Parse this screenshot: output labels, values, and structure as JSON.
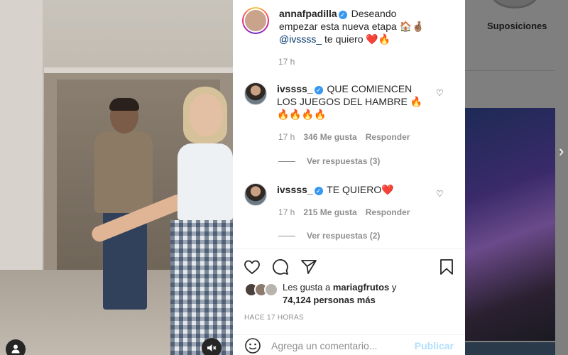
{
  "background": {
    "suggestions_label": "Suposiciones"
  },
  "caption": {
    "username": "annafpadilla",
    "text_before_mention": " Deseando empezar esta nueva etapa 🏠🤞🏽 ",
    "mention": "@ivssss_",
    "text_after_mention": " te quiero ❤️🔥",
    "time": "17 h"
  },
  "comments": [
    {
      "username": "ivssss_",
      "text": " QUE COMIENCEN LOS JUEGOS DEL HAMBRE 🔥🔥🔥🔥🔥",
      "time": "17 h",
      "likes": "346 Me gusta",
      "reply_label": "Responder",
      "view_replies": "Ver respuestas (3)"
    },
    {
      "username": "ivssss_",
      "text": " TE QUIERO❤️",
      "time": "17 h",
      "likes": "215 Me gusta",
      "reply_label": "Responder",
      "view_replies": "Ver respuestas (2)"
    }
  ],
  "likes": {
    "prefix": "Les gusta a ",
    "user": "mariagfrutos",
    "middle": " y ",
    "count": "74,124 personas más"
  },
  "post_time": "HACE 17 HORAS",
  "add_comment": {
    "placeholder": "Agrega un comentario...",
    "post_label": "Publicar"
  },
  "colors": {
    "verified": "#3897f0",
    "mention": "#00376b",
    "muted_text": "#8e8e8e",
    "post_disabled": "#b2dffc"
  }
}
